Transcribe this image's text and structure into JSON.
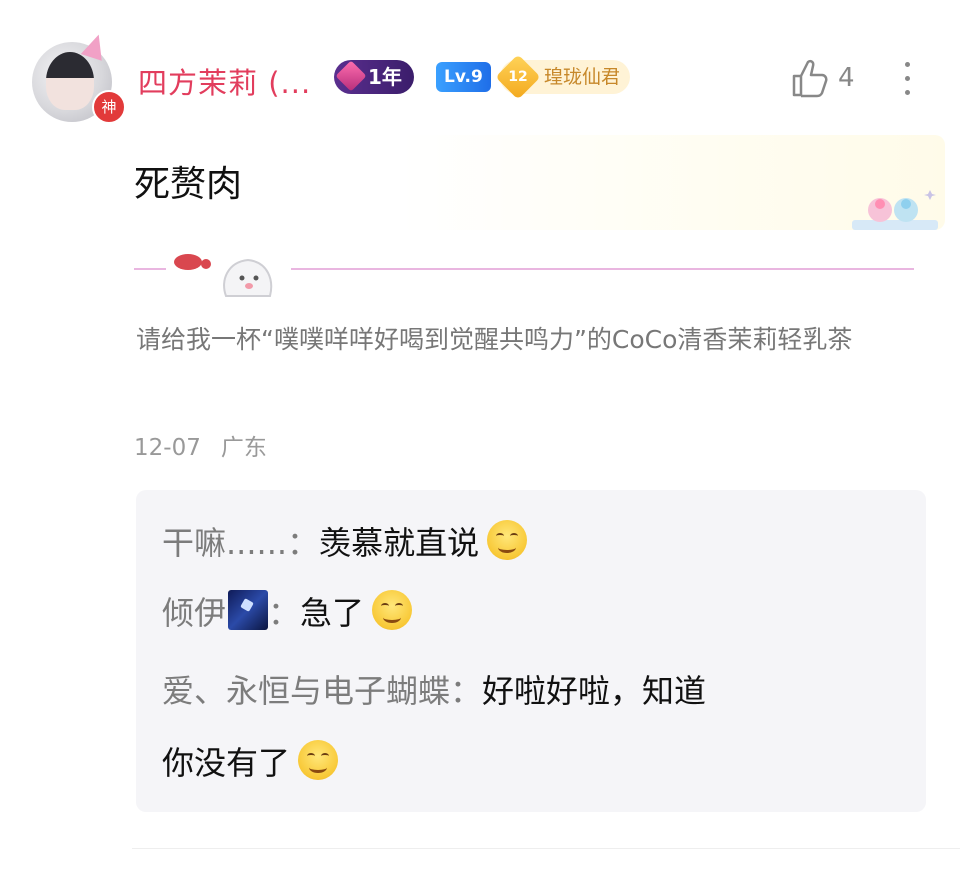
{
  "post": {
    "user": {
      "name": "四方茉莉 (...",
      "avatar_badge": "神",
      "year_badge": "1年",
      "level": "Lv.9",
      "title_number": "12",
      "title": "瑝珑仙君"
    },
    "likes": "4",
    "content": "死赘肉",
    "signature": "请给我一杯“噗噗咩咩好喝到觉醒共鸣力”的CoCo清香茉莉轻乳茶",
    "date": "12-07",
    "location": "广东"
  },
  "replies": [
    {
      "name": "干嘛......",
      "sep": "：",
      "text": "羡慕就直说",
      "emoji": "smile-emoji"
    },
    {
      "name": "倾伊",
      "sep": "：",
      "text": "急了",
      "emoji": "cover-mouth-emoji",
      "name_icon": "galaxy-image-icon"
    },
    {
      "name": "爱、永恒与电子蝴蝶",
      "sep": "：",
      "text": "好啦好啦，知道",
      "text2": "你没有了",
      "emoji": "smile-emoji"
    }
  ],
  "colors": {
    "username": "#e23d5d",
    "divider": "#e9b6e0",
    "reply_bg": "#f5f5f8",
    "reply_name": "#7c7c7c"
  }
}
